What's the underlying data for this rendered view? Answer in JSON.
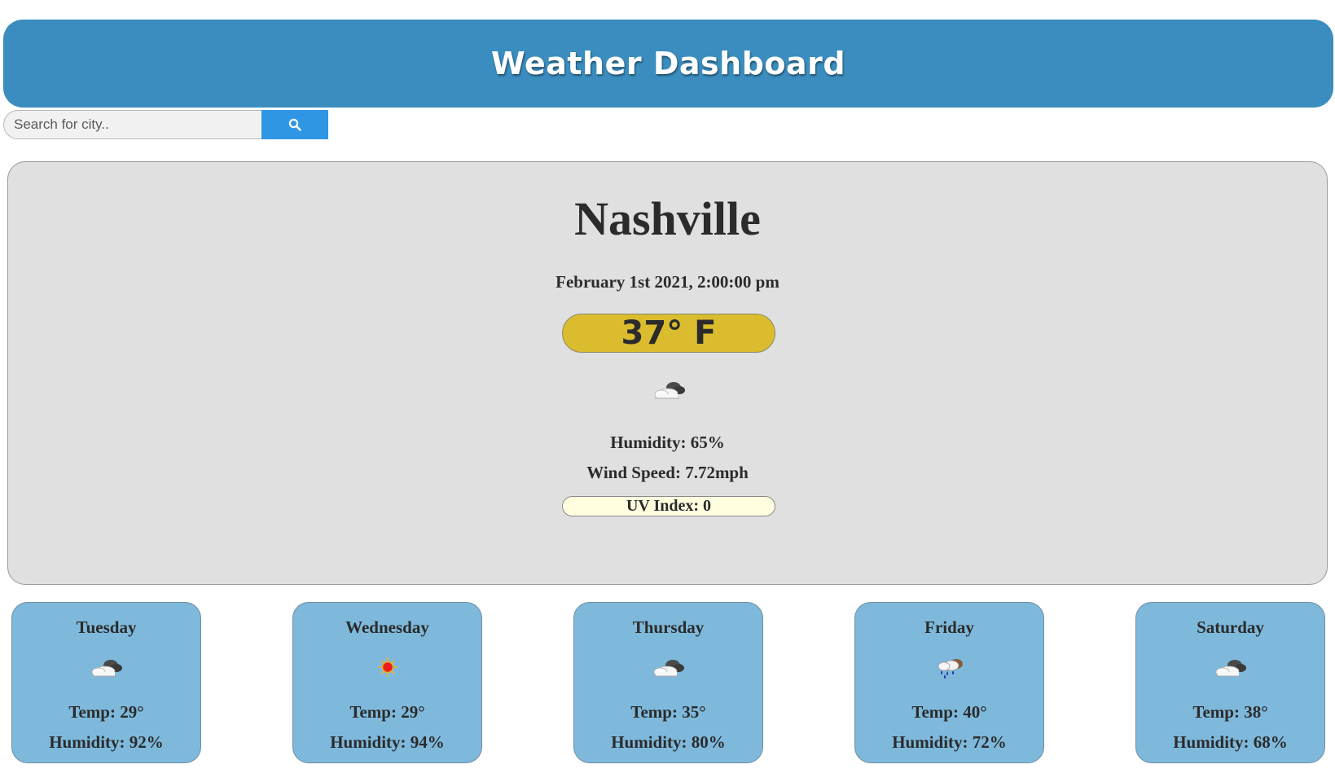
{
  "header": {
    "title": "Weather Dashboard"
  },
  "search": {
    "placeholder": "Search for city..",
    "value": "",
    "button_icon": "search-icon"
  },
  "current": {
    "city": "Nashville",
    "datetime": "February 1st 2021, 2:00:00 pm",
    "temperature": "37° F",
    "icon": "partly-cloudy-icon",
    "humidity": "Humidity: 65%",
    "wind_speed": "Wind Speed: 7.72mph",
    "uv_index": "UV Index: 0"
  },
  "forecast": [
    {
      "day": "Tuesday",
      "icon": "partly-cloudy-icon",
      "temp": "Temp: 29°",
      "humidity": "Humidity: 92%"
    },
    {
      "day": "Wednesday",
      "icon": "sun-icon",
      "temp": "Temp: 29°",
      "humidity": "Humidity: 94%"
    },
    {
      "day": "Thursday",
      "icon": "partly-cloudy-icon",
      "temp": "Temp: 35°",
      "humidity": "Humidity: 80%"
    },
    {
      "day": "Friday",
      "icon": "rain-cloud-icon",
      "temp": "Temp: 40°",
      "humidity": "Humidity: 72%"
    },
    {
      "day": "Saturday",
      "icon": "partly-cloudy-icon",
      "temp": "Temp: 38°",
      "humidity": "Humidity: 68%"
    }
  ],
  "colors": {
    "header_bg": "#3a8dbe",
    "search_button": "#2f96e6",
    "temp_badge": "#dabc2e",
    "uv_badge": "#ffffe0",
    "card_bg": "#7eb9dc",
    "panel_bg": "#e0e0e0"
  }
}
